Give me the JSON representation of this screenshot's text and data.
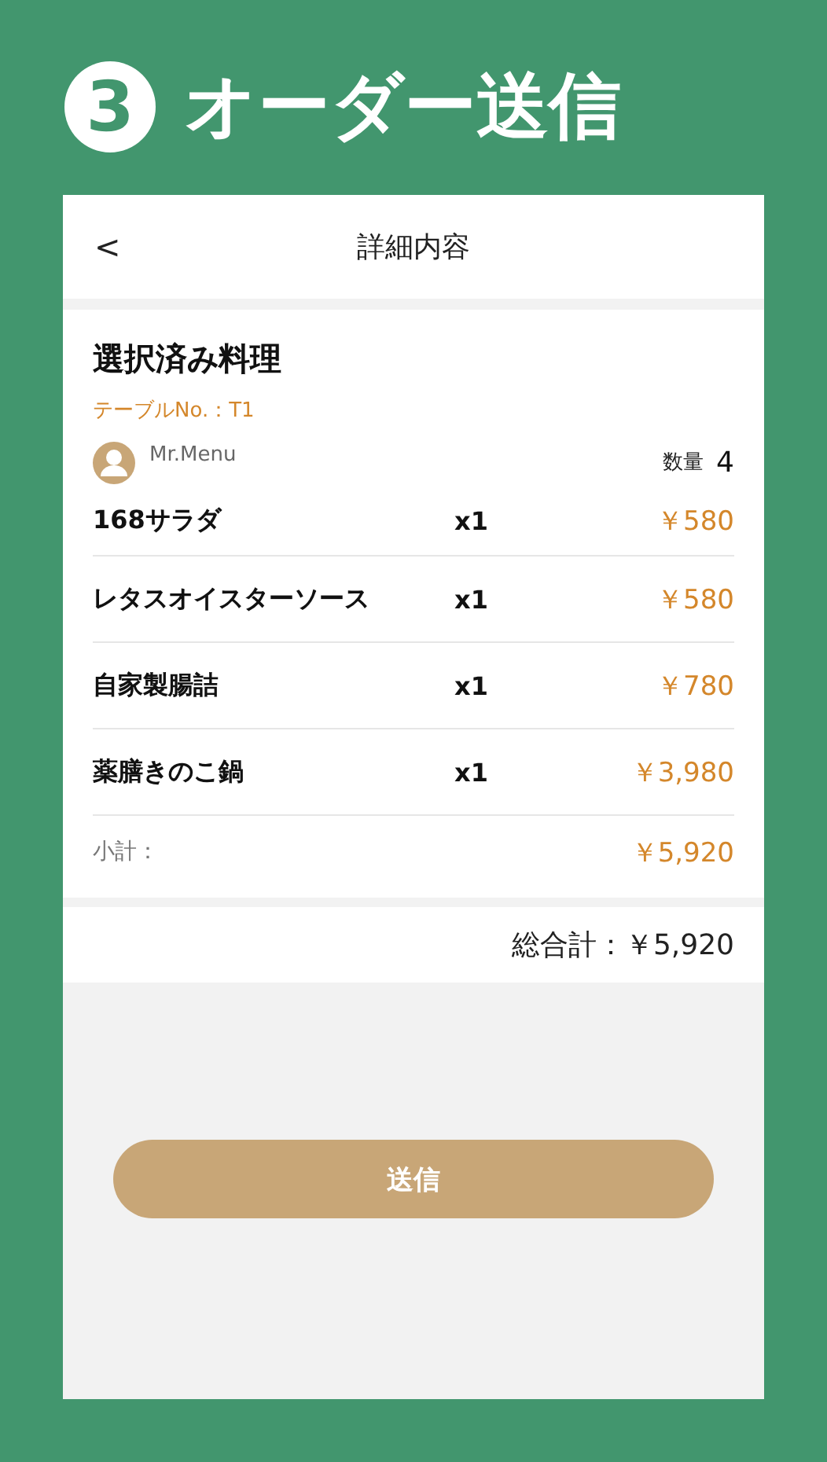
{
  "banner": {
    "step": "3",
    "title": "オーダー送信"
  },
  "nav": {
    "back": "<",
    "title": "詳細内容"
  },
  "order": {
    "heading": "選択済み料理",
    "table": "テーブルNo.：T1",
    "user": "Mr.Menu",
    "quantity_label": "数量",
    "quantity": "4",
    "items": [
      {
        "name": "168サラダ",
        "qty": "x1",
        "price": "￥580"
      },
      {
        "name": "レタスオイスターソース",
        "qty": "x1",
        "price": "￥580"
      },
      {
        "name": "自家製腸詰",
        "qty": "x1",
        "price": "￥780"
      },
      {
        "name": "薬膳きのこ鍋",
        "qty": "x1",
        "price": "￥3,980"
      }
    ],
    "subtotal_label": "小計：",
    "subtotal": "￥5,920"
  },
  "total": "総合計：￥5,920",
  "submit": "送信"
}
